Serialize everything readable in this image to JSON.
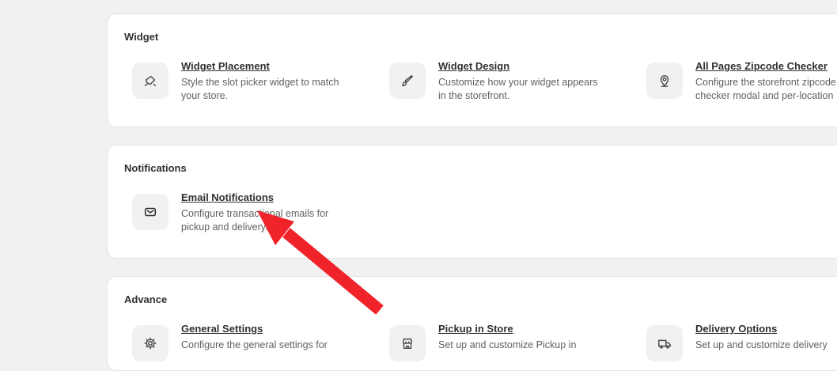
{
  "sections": {
    "widget": {
      "title": "Widget",
      "items": [
        {
          "title": "Widget Placement",
          "description": "Style the slot picker widget to match your store.",
          "icon": "brush-icon"
        },
        {
          "title": "Widget Design",
          "description": "Customize how your widget appears in the storefront.",
          "icon": "paintbrush-icon"
        },
        {
          "title": "All Pages Zipcode Checker",
          "description": "Configure the storefront zipcode checker modal and per-location",
          "icon": "location-pin-icon"
        }
      ]
    },
    "notifications": {
      "title": "Notifications",
      "items": [
        {
          "title": "Email Notifications",
          "description": "Configure transactional emails for pickup and delivery.",
          "icon": "envelope-icon"
        }
      ]
    },
    "advance": {
      "title": "Advance",
      "items": [
        {
          "title": "General Settings",
          "description": "Configure the general settings for",
          "icon": "gear-icon"
        },
        {
          "title": "Pickup in Store",
          "description": "Set up and customize Pickup in",
          "icon": "store-icon"
        },
        {
          "title": "Delivery Options",
          "description": "Set up and customize delivery",
          "icon": "truck-icon"
        }
      ]
    }
  },
  "colors": {
    "background": "#f1f1f1",
    "card": "#ffffff",
    "annotation_arrow": "#f0222a"
  }
}
